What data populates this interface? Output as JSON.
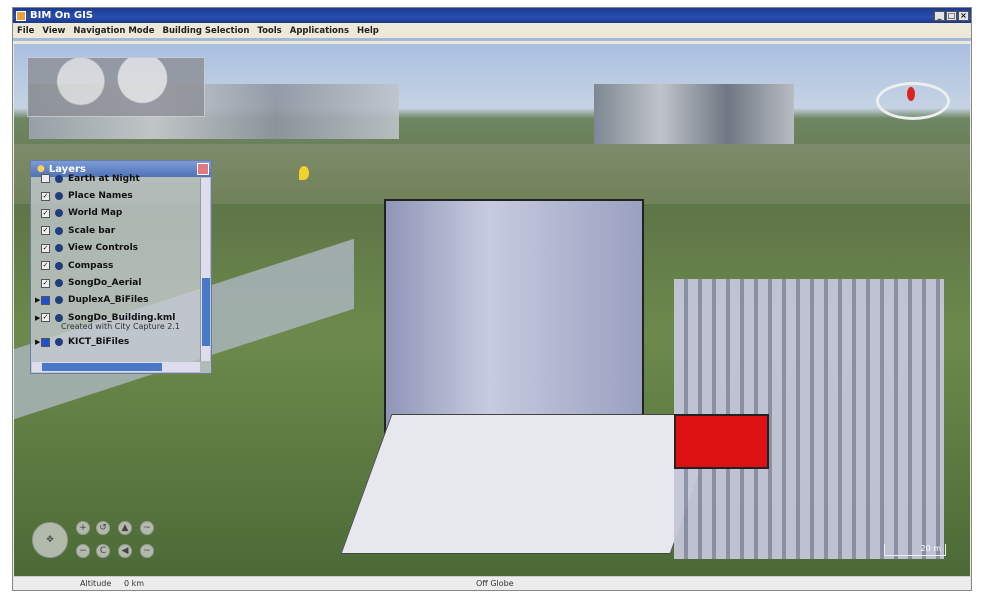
{
  "window": {
    "title": "BIM On GIS"
  },
  "menu": [
    "File",
    "View",
    "Navigation Mode",
    "Building Selection",
    "Tools",
    "Applications",
    "Help"
  ],
  "layers": {
    "title": "Layers",
    "items": [
      {
        "label": "Earth at Night",
        "checked": false,
        "expandable": false
      },
      {
        "label": "Place Names",
        "checked": true,
        "expandable": false
      },
      {
        "label": "World Map",
        "checked": true,
        "expandable": false
      },
      {
        "label": "Scale bar",
        "checked": true,
        "expandable": false
      },
      {
        "label": "View Controls",
        "checked": true,
        "expandable": false
      },
      {
        "label": "Compass",
        "checked": true,
        "expandable": false
      },
      {
        "label": "SongDo_Aerial",
        "checked": true,
        "expandable": false
      },
      {
        "label": "DuplexA_BiFiles",
        "checked": "blue",
        "expandable": true
      },
      {
        "label": "SongDo_Building.kml",
        "checked": true,
        "expandable": true,
        "sub": "Created with City Capture 2.1"
      },
      {
        "label": "KICT_BiFiles",
        "checked": "blue",
        "expandable": true
      }
    ]
  },
  "scalebar": "20 m",
  "status": {
    "altitude_label": "Altitude",
    "altitude_value": "0 km",
    "position": "Off Globe"
  },
  "icons": {
    "compass": "compass-icon",
    "pan": "pan-control-icon",
    "zoom_in": "plus-icon",
    "zoom_out": "minus-icon"
  }
}
